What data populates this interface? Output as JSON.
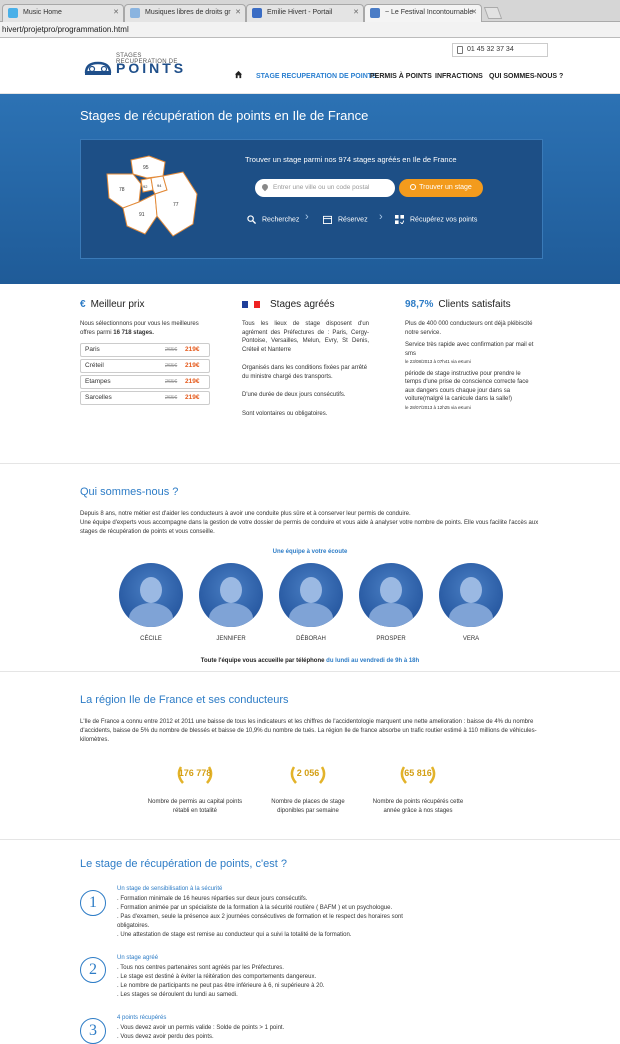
{
  "browser": {
    "tabs": [
      {
        "label": "Music Home",
        "fav": "#4ab0e8"
      },
      {
        "label": "Musiques libres de droits gr",
        "fav": "#8ab4e0"
      },
      {
        "label": "Emilie Hivert - Portail",
        "fav": "#3a6cc4"
      },
      {
        "label": "~ Le Festival Incontournable",
        "fav": "#4a7cc6"
      }
    ],
    "url": "hivert/projetpro/programmation.html"
  },
  "header": {
    "phone": "01 45 32 37 34",
    "logo_top": "STAGES RECUPERATION DE",
    "logo_main": "POINTS",
    "nav": [
      "STAGE RECUPERATION DE POINTS",
      "PERMIS À POINTS",
      "INFRACTIONS",
      "QUI SOMMES-NOUS ?"
    ]
  },
  "hero": {
    "title": "Stages de récupération de points en Ile de France",
    "panel_text": "Trouver un stage parmi nos 974 stages agréés en Ile de France",
    "search_placeholder": "Entrer une ville ou un code postal",
    "search_button": "Trouver un stage",
    "steps": [
      "Recherchez",
      "Réservez",
      "Récupérez vos points"
    ],
    "map_labels": [
      "95",
      "78",
      "92",
      "94",
      "91",
      "77"
    ]
  },
  "features": {
    "best_price": {
      "title": "Meilleur prix",
      "text_a": "Nous sélectionnons pour vous les meilleures offres parmi ",
      "text_b": "16 718 stages.",
      "rows": [
        {
          "city": "Paris",
          "old": "265€",
          "new": "219€"
        },
        {
          "city": "Créteil",
          "old": "265€",
          "new": "219€"
        },
        {
          "city": "Etampes",
          "old": "265€",
          "new": "219€"
        },
        {
          "city": "Sarcelles",
          "old": "265€",
          "new": "219€"
        }
      ]
    },
    "agreed": {
      "title": "Stages agréés",
      "p1": "Tous les lieux de stage disposent d'un agrément des Préfectures de : Paris, Cergy-Pontoise, Versailles, Melun, Evry, St Denis, Créteil et Nanterre",
      "p2": "Organisés dans les conditions fixées par arrêté du ministre chargé des transports.",
      "p3": "D'une durée de deux jours consécutifs.",
      "p4": "Sont volontaires ou obligatoires."
    },
    "satisfied": {
      "pct": "98,7%",
      "title": "Clients satisfaits",
      "p1": "Plus de 400 000 conducteurs ont déjà plébiscité notre service.",
      "r1": "Service très rapide avec confirmation par mail et sms",
      "r1_meta": "le 23/08/2013 à 07h41 via eKumi",
      "r2": "période de stage instructive pour prendre le temps d'une prise de conscience correcte face aux dangers cours chaque jour dans sa voiture(malgré la canicule dans la salle!)",
      "r2_meta": "le 28/07/2013 à 12h25 via eKumi"
    }
  },
  "about": {
    "title": "Qui sommes-nous ?",
    "p1": "Depuis 8 ans, notre métier est d'aider les conducteurs à avoir une conduite plus sûre et à conserver leur permis de conduire.",
    "p2": "Une équipe d'experts vous accompagne dans la gestion de votre dossier de permis de conduire et vous aide à analyser votre nombre de points. Elle vous facilite l'accès aux stages de récupération de points et vous conseille.",
    "team_heading": "Une équipe à votre écoute",
    "team": [
      "CÉCILE",
      "JENNIFER",
      "DÉBORAH",
      "PROSPER",
      "VERA"
    ],
    "phone_a": "Toute l'équipe vous accueille par téléphone",
    "phone_b": "du lundi au vendredi de 9h à 18h"
  },
  "region": {
    "title": "La région Ile de France et ses conducteurs",
    "text": "L'Ile de France a connu entre 2012 et 2011 une baisse de tous les indicateurs et les chiffres de l'accidentologie marquent une nette amelioration : baisse de 4% du nombre d'accidents, baisse de 5% du nombre de blessés et baisse de 10,9% du nombre de tués. La région Ile de france absorbe un trafic routier estimé à 110 millions de véhicules-kilomètres.",
    "stats": [
      {
        "value": "176 778",
        "label": "Nombre de permis au capital points rétabli en totalité"
      },
      {
        "value": "2 056",
        "label": "Nombre de places de stage diponibles par semaine"
      },
      {
        "value": "65 816",
        "label": "Nombre de points récupérés cette année grâce à nos stages"
      }
    ]
  },
  "stage": {
    "title": "Le stage de récupération de points, c'est ?",
    "items": [
      {
        "n": "1",
        "title": "Un stage de sensibilisation à la sécurité",
        "lines": [
          ". Formation minimale de 16 heures réparties sur deux jours consécutifs.",
          ". Formation animée par un spécialiste de la formation à la sécurité routière ( BAFM ) et un psychologue.",
          ". Pas d'examen, seule la présence aux 2 journées consécutives de formation et le respect des horaires sont obligatoires.",
          ". Une attestation de stage est remise au conducteur qui a suivi la totalité de la formation."
        ]
      },
      {
        "n": "2",
        "title": "Un stage agréé",
        "lines": [
          ". Tous nos centres partenaires sont agréés par les Préfectures.",
          ". Le stage est destiné à éviter la réitération des comportements dangereux.",
          ". Le nombre de participants ne peut pas être inférieure à 6, ni supérieure à 20.",
          ". Les stages se déroulent du lundi au samedi."
        ]
      },
      {
        "n": "3",
        "title": "4 points récupérés",
        "lines": [
          ". Vous devez avoir un permis valide : Solde de points > 1 point.",
          ". Vous devez avoir perdu des points."
        ]
      }
    ]
  }
}
